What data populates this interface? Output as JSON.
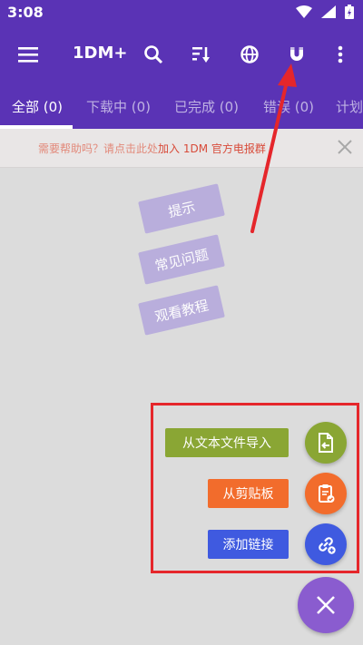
{
  "status": {
    "time": "3:08"
  },
  "appbar": {
    "title": "1DM+"
  },
  "tabs": [
    {
      "label": "全部 (0)"
    },
    {
      "label": "下载中 (0)"
    },
    {
      "label": "已完成 (0)"
    },
    {
      "label": "错误 (0)"
    },
    {
      "label": "计划"
    }
  ],
  "help": {
    "text": "需要帮助吗？请点击此处",
    "link": "加入 1DM 官方电报群"
  },
  "cards": {
    "tips": "提示",
    "faq": "常见问题",
    "tutorial": "观看教程"
  },
  "fab_actions": {
    "import_text": "从文本文件导入",
    "clipboard": "从剪贴板",
    "add_link": "添加链接"
  },
  "colors": {
    "primary": "#5a33b5",
    "import_green": "#8aa634",
    "clipboard_orange": "#f26c2c",
    "link_blue": "#3f5ae0",
    "fab_purple": "#8a5ccf",
    "annotation_red": "#e5262b"
  }
}
